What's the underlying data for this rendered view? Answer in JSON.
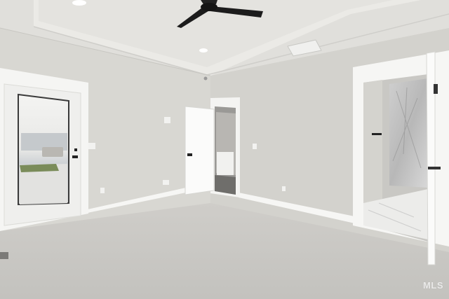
{
  "watermark": {
    "text": "MLS"
  },
  "colors": {
    "wall": "#d6d5d0",
    "ceiling": "#e6e5e1",
    "trim": "#f7f7f5",
    "carpet": "#c9c8c4",
    "fan": "#1c1c1c"
  }
}
